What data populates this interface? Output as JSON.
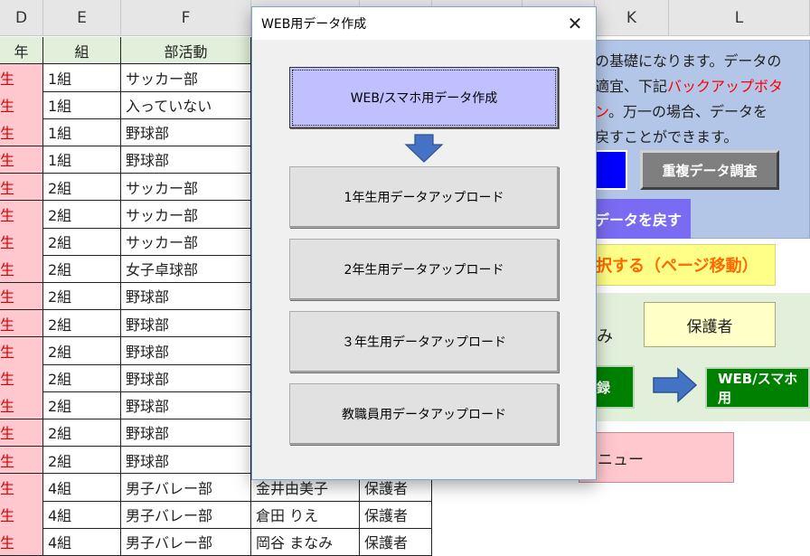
{
  "columns": {
    "D": "D",
    "E": "E",
    "F": "F",
    "K": "K",
    "L": "L"
  },
  "sheet": {
    "headers": {
      "grade": "年",
      "class": "組",
      "club": "部活動"
    },
    "rows": [
      {
        "grade": "生",
        "class": "1組",
        "club": "サッカー部"
      },
      {
        "grade": "生",
        "class": "1組",
        "club": "入っていない"
      },
      {
        "grade": "生",
        "class": "1組",
        "club": "野球部"
      },
      {
        "grade": "生",
        "class": "1組",
        "club": "野球部"
      },
      {
        "grade": "生",
        "class": "2組",
        "club": "サッカー部"
      },
      {
        "grade": "生",
        "class": "2組",
        "club": "サッカー部"
      },
      {
        "grade": "生",
        "class": "2組",
        "club": "サッカー部"
      },
      {
        "grade": "生",
        "class": "2組",
        "club": "女子卓球部"
      },
      {
        "grade": "生",
        "class": "2組",
        "club": "野球部"
      },
      {
        "grade": "生",
        "class": "2組",
        "club": "野球部"
      },
      {
        "grade": "生",
        "class": "2組",
        "club": "野球部"
      },
      {
        "grade": "生",
        "class": "2組",
        "club": "野球部"
      },
      {
        "grade": "生",
        "class": "2組",
        "club": "野球部"
      },
      {
        "grade": "生",
        "class": "2組",
        "club": "野球部"
      },
      {
        "grade": "生",
        "class": "2組",
        "club": "野球部"
      },
      {
        "grade": "生",
        "class": "4組",
        "club": "男子バレー部",
        "name": "金井由美子",
        "role": "保護者"
      },
      {
        "grade": "生",
        "class": "4組",
        "club": "男子バレー部",
        "name": "倉田 りえ",
        "role": "保護者"
      },
      {
        "grade": "生",
        "class": "4組",
        "club": "男子バレー部",
        "name": "岡谷 まなみ",
        "role": "保護者"
      }
    ]
  },
  "panel": {
    "line1": "の基礎になります。データの",
    "line2a": "適宜、下記",
    "line2b": "バックアップボタ",
    "line3a": "ン",
    "line3b": "。万一の場合、データを",
    "line4": "戻すことができます。",
    "dup_check_label": "重複データ調査",
    "restore_label": "データを戻す",
    "select_label": "択する（ページ移動）",
    "mi_text": "み",
    "guardian_label": "保護者",
    "register_label": "録",
    "web_label": "WEB/スマホ用",
    "menu_label": "ニュー"
  },
  "dialog": {
    "title": "WEB用データ作成",
    "close_glyph": "✕",
    "create_label": "WEB/スマホ用データ作成",
    "upload1_label": "1年生用データアップロード",
    "upload2_label": "2年生用データアップロード",
    "upload3_label": "３年生用データアップロード",
    "staff_label": "教職員用データアップロード"
  },
  "colors": {
    "accent_blue": "#0000ff",
    "arrow_blue": "#4472c4",
    "dialog_primary": "#c0c0ff"
  },
  "icons": {
    "arrow_down": "down-arrow-icon",
    "arrow_right": "right-arrow-icon"
  }
}
